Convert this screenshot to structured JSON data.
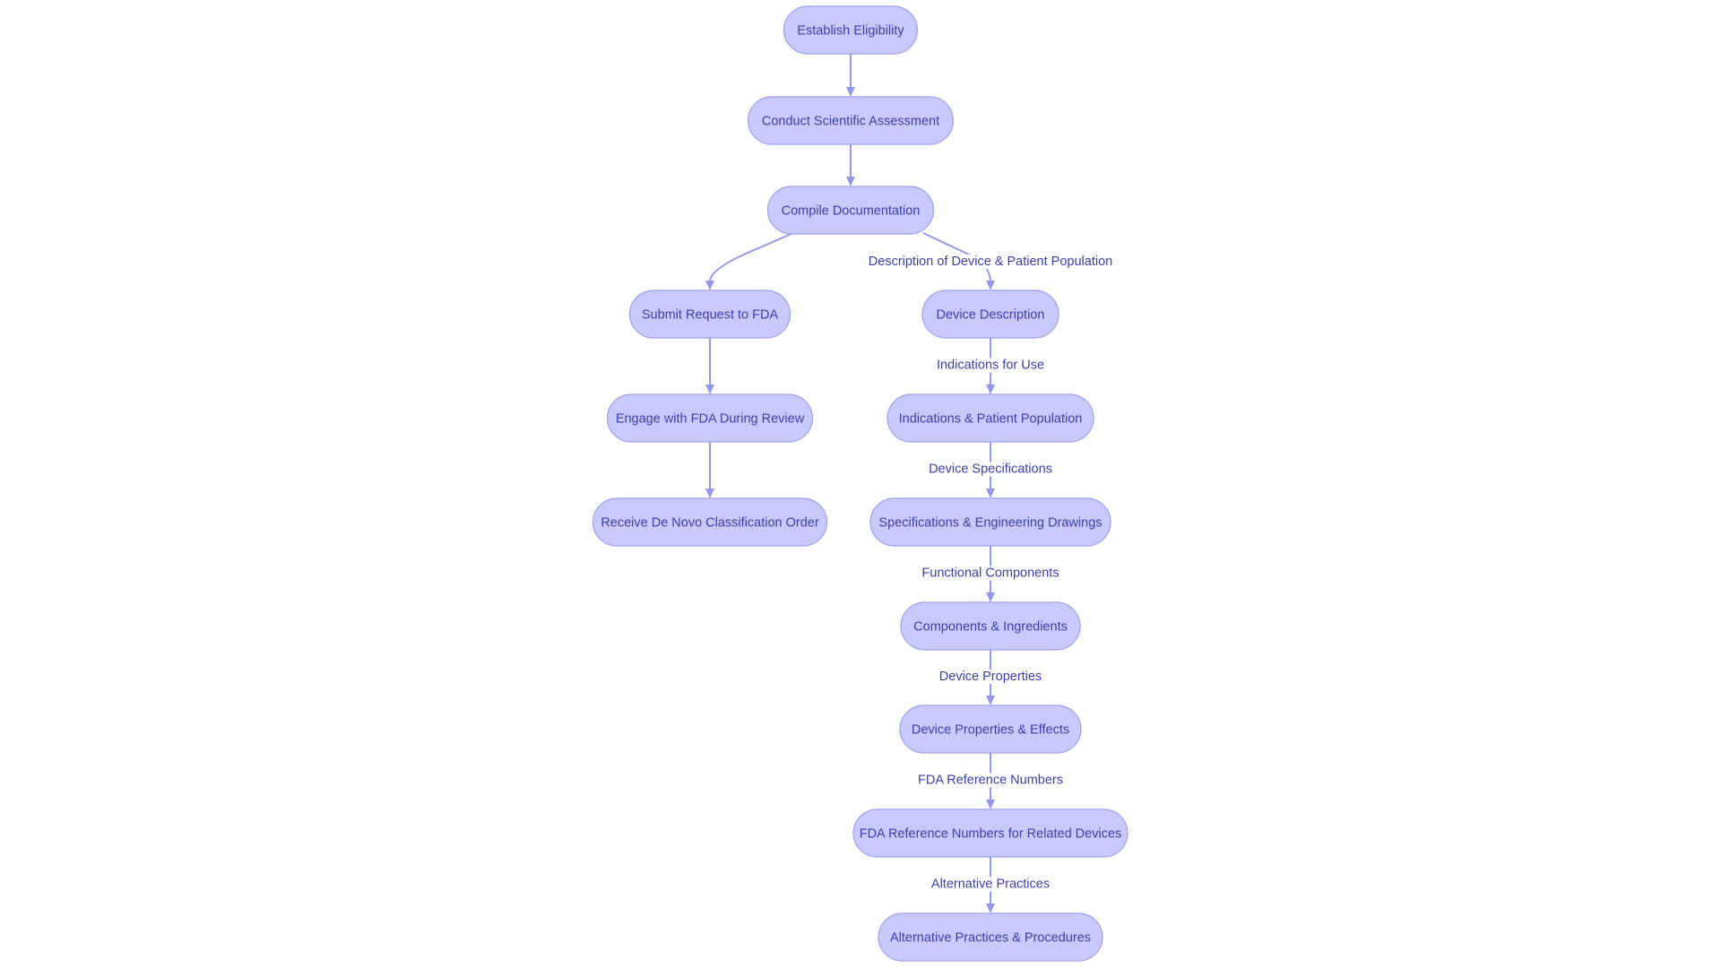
{
  "diagram": {
    "type": "flowchart",
    "colors": {
      "node_fill": "#C8CAFB",
      "node_stroke": "#9EA1EC",
      "text": "#3C3FA8",
      "edge": "#9598E6",
      "background": "#FFFFFF"
    },
    "nodes": [
      {
        "id": "eligibility",
        "label": "Establish Eligibility"
      },
      {
        "id": "assessment",
        "label": "Conduct Scientific Assessment"
      },
      {
        "id": "documentation",
        "label": "Compile Documentation"
      },
      {
        "id": "submit",
        "label": "Submit Request to FDA"
      },
      {
        "id": "engage",
        "label": "Engage with FDA During Review"
      },
      {
        "id": "receive",
        "label": "Receive De Novo Classification Order"
      },
      {
        "id": "device_desc",
        "label": "Device Description"
      },
      {
        "id": "indications",
        "label": "Indications & Patient Population"
      },
      {
        "id": "specs",
        "label": "Specifications & Engineering Drawings"
      },
      {
        "id": "components",
        "label": "Components & Ingredients"
      },
      {
        "id": "properties",
        "label": "Device Properties & Effects"
      },
      {
        "id": "fda_refs",
        "label": "FDA Reference Numbers for Related Devices"
      },
      {
        "id": "alternatives",
        "label": "Alternative Practices & Procedures"
      }
    ],
    "edges": [
      {
        "from": "eligibility",
        "to": "assessment",
        "label": ""
      },
      {
        "from": "assessment",
        "to": "documentation",
        "label": ""
      },
      {
        "from": "documentation",
        "to": "submit",
        "label": ""
      },
      {
        "from": "documentation",
        "to": "device_desc",
        "label": "Description of Device & Patient Population"
      },
      {
        "from": "submit",
        "to": "engage",
        "label": ""
      },
      {
        "from": "engage",
        "to": "receive",
        "label": ""
      },
      {
        "from": "device_desc",
        "to": "indications",
        "label": "Indications for Use"
      },
      {
        "from": "indications",
        "to": "specs",
        "label": "Device Specifications"
      },
      {
        "from": "specs",
        "to": "components",
        "label": "Functional Components"
      },
      {
        "from": "components",
        "to": "properties",
        "label": "Device Properties"
      },
      {
        "from": "properties",
        "to": "fda_refs",
        "label": "FDA Reference Numbers"
      },
      {
        "from": "fda_refs",
        "to": "alternatives",
        "label": "Alternative Practices"
      }
    ]
  }
}
